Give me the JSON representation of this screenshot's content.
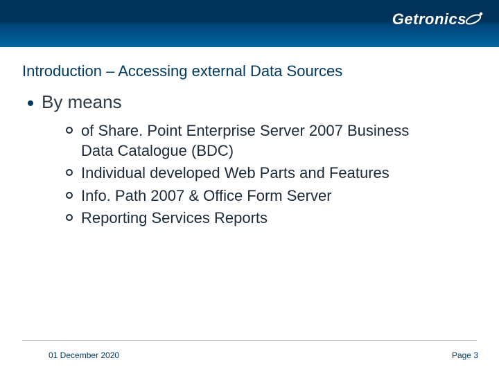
{
  "brand": {
    "name": "Getronics"
  },
  "slide": {
    "title": "Introduction – Accessing external Data Sources",
    "lead": "By means",
    "items": [
      "of Share. Point Enterprise Server 2007 Business Data Catalogue (BDC)",
      "Individual developed Web Parts and Features",
      "Info. Path 2007 & Office Form Server",
      "Reporting Services Reports"
    ]
  },
  "footer": {
    "date": "01 December 2020",
    "page": "Page 3"
  }
}
